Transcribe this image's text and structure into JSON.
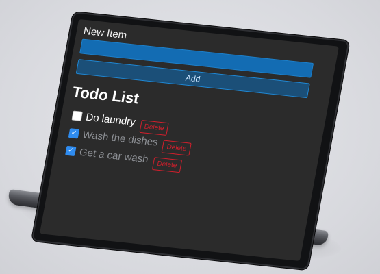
{
  "form": {
    "label": "New Item",
    "input_value": "",
    "add_label": "Add"
  },
  "list": {
    "title": "Todo List",
    "items": [
      {
        "text": "Do laundry",
        "checked": false,
        "delete_label": "Delete"
      },
      {
        "text": "Wash the dishes",
        "checked": true,
        "delete_label": "Delete"
      },
      {
        "text": "Get a car wash",
        "checked": true,
        "delete_label": "Delete"
      }
    ]
  },
  "colors": {
    "screen_background": "#2b2b2b",
    "input_background": "#136cb3",
    "button_background": "#1b4f78",
    "accent_blue": "#1f87d3",
    "checkbox_blue": "#2f8cf0",
    "delete_red": "#d11f2c",
    "done_text": "#8c8f94"
  },
  "icons": {
    "checkmark": "check-icon"
  }
}
